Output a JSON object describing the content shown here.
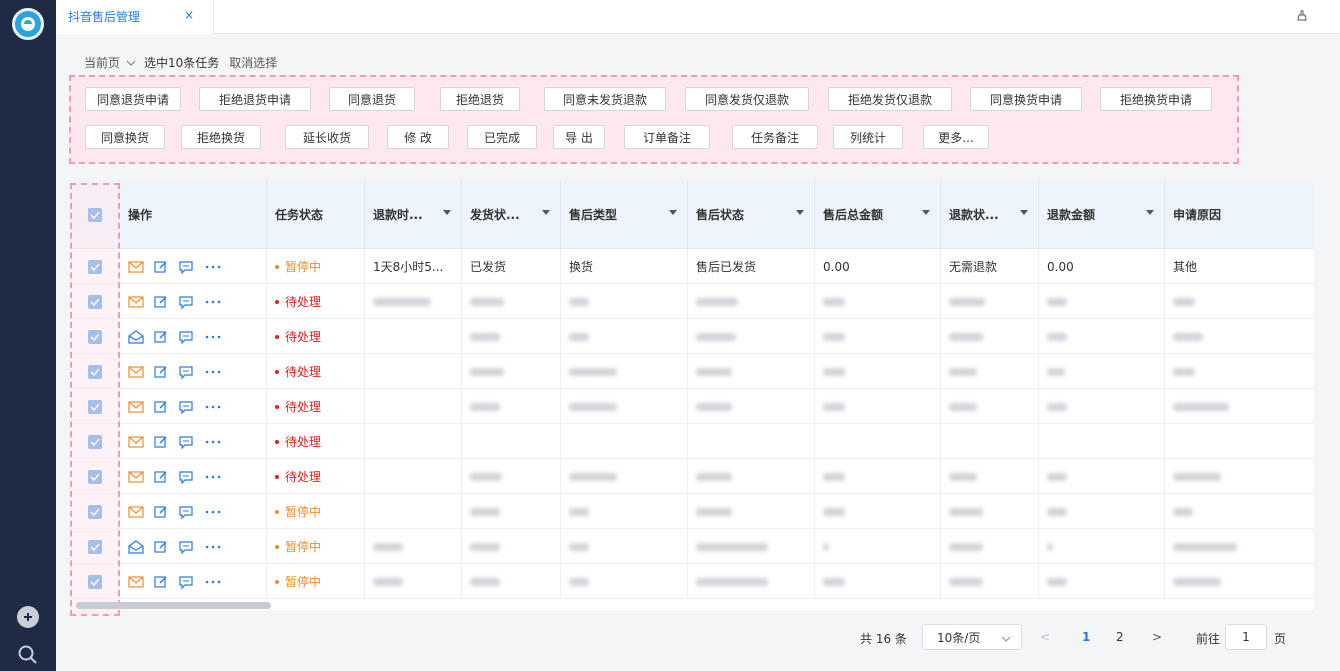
{
  "tab": {
    "title": "抖音售后管理",
    "close": "×"
  },
  "toolbar": {
    "current_page": "当前页",
    "selected": "选中10条任务",
    "cancel": "取消选择"
  },
  "actions_row1": [
    "同意退货申请",
    "拒绝退货申请",
    "同意退货",
    "拒绝退货",
    "同意未发货退款",
    "同意发货仅退款",
    "拒绝发货仅退款",
    "同意换货申请",
    "拒绝换货申请"
  ],
  "actions_row2": [
    "同意换货",
    "拒绝换货",
    "延长收货",
    "修 改",
    "已完成",
    "导 出",
    "订单备注",
    "任务备注",
    "列统计",
    "更多..."
  ],
  "columns": [
    "操作",
    "任务状态",
    "退款时...",
    "发货状...",
    "售后类型",
    "售后状态",
    "售后总金额",
    "退款状...",
    "退款金额",
    "申请原因"
  ],
  "rows": [
    {
      "status": "暂停中",
      "status_type": "pause",
      "refund_time": "1天8小时5...",
      "ship": "已发货",
      "type": "换货",
      "after_status": "售后已发货",
      "total": "0.00",
      "refund_status": "无需退款",
      "refund_amount": "0.00",
      "reason": "其他",
      "mail": "envelope"
    },
    {
      "status": "待处理",
      "status_type": "pending",
      "mail": "envelope"
    },
    {
      "status": "待处理",
      "status_type": "pending",
      "mail": "envelope-open"
    },
    {
      "status": "待处理",
      "status_type": "pending",
      "mail": "envelope"
    },
    {
      "status": "待处理",
      "status_type": "pending",
      "mail": "envelope"
    },
    {
      "status": "待处理",
      "status_type": "pending",
      "mail": "envelope"
    },
    {
      "status": "待处理",
      "status_type": "pending",
      "mail": "envelope"
    },
    {
      "status": "暂停中",
      "status_type": "pause",
      "mail": "envelope"
    },
    {
      "status": "暂停中",
      "status_type": "pause",
      "mail": "envelope-open"
    },
    {
      "status": "暂停中",
      "status_type": "pause",
      "mail": "envelope"
    }
  ],
  "pagination": {
    "total": "共 16 条",
    "page_size": "10条/页",
    "prev": "<",
    "pages": [
      "1",
      "2"
    ],
    "current": "1",
    "next": ">",
    "goto": "前往",
    "goto_value": "1",
    "unit": "页"
  },
  "colors": {
    "accent": "#2a7ae2",
    "pause": "#f08c2e",
    "pending": "#e02020",
    "highlight": "#f09bb7"
  }
}
